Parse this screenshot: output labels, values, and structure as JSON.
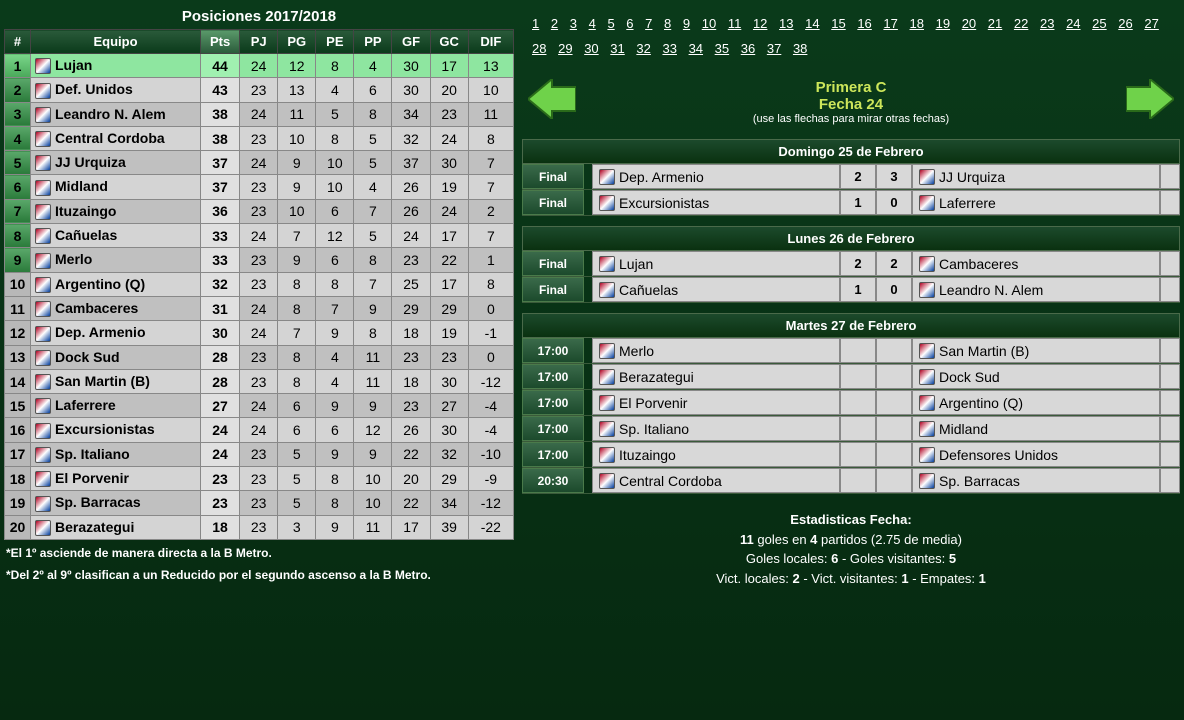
{
  "standings": {
    "title": "Posiciones 2017/2018",
    "headers": {
      "rank": "#",
      "team": "Equipo",
      "pts": "Pts",
      "pj": "PJ",
      "pg": "PG",
      "pe": "PE",
      "pp": "PP",
      "gf": "GF",
      "gc": "GC",
      "dif": "DIF"
    },
    "rows": [
      {
        "rank": "1",
        "team": "Lujan",
        "pts": "44",
        "pj": "24",
        "pg": "12",
        "pe": "8",
        "pp": "4",
        "gf": "30",
        "gc": "17",
        "dif": "13",
        "tier": "top"
      },
      {
        "rank": "2",
        "team": "Def. Unidos",
        "pts": "43",
        "pj": "23",
        "pg": "13",
        "pe": "4",
        "pp": "6",
        "gf": "30",
        "gc": "20",
        "dif": "10",
        "tier": "mid"
      },
      {
        "rank": "3",
        "team": "Leandro N. Alem",
        "pts": "38",
        "pj": "24",
        "pg": "11",
        "pe": "5",
        "pp": "8",
        "gf": "34",
        "gc": "23",
        "dif": "11",
        "tier": "mid"
      },
      {
        "rank": "4",
        "team": "Central Cordoba",
        "pts": "38",
        "pj": "23",
        "pg": "10",
        "pe": "8",
        "pp": "5",
        "gf": "32",
        "gc": "24",
        "dif": "8",
        "tier": "mid"
      },
      {
        "rank": "5",
        "team": "JJ Urquiza",
        "pts": "37",
        "pj": "24",
        "pg": "9",
        "pe": "10",
        "pp": "5",
        "gf": "37",
        "gc": "30",
        "dif": "7",
        "tier": "mid"
      },
      {
        "rank": "6",
        "team": "Midland",
        "pts": "37",
        "pj": "23",
        "pg": "9",
        "pe": "10",
        "pp": "4",
        "gf": "26",
        "gc": "19",
        "dif": "7",
        "tier": "mid"
      },
      {
        "rank": "7",
        "team": "Ituzaingo",
        "pts": "36",
        "pj": "23",
        "pg": "10",
        "pe": "6",
        "pp": "7",
        "gf": "26",
        "gc": "24",
        "dif": "2",
        "tier": "mid"
      },
      {
        "rank": "8",
        "team": "Cañuelas",
        "pts": "33",
        "pj": "24",
        "pg": "7",
        "pe": "12",
        "pp": "5",
        "gf": "24",
        "gc": "17",
        "dif": "7",
        "tier": "mid"
      },
      {
        "rank": "9",
        "team": "Merlo",
        "pts": "33",
        "pj": "23",
        "pg": "9",
        "pe": "6",
        "pp": "8",
        "gf": "23",
        "gc": "22",
        "dif": "1",
        "tier": "mid"
      },
      {
        "rank": "10",
        "team": "Argentino (Q)",
        "pts": "32",
        "pj": "23",
        "pg": "8",
        "pe": "8",
        "pp": "7",
        "gf": "25",
        "gc": "17",
        "dif": "8",
        "tier": "low"
      },
      {
        "rank": "11",
        "team": "Cambaceres",
        "pts": "31",
        "pj": "24",
        "pg": "8",
        "pe": "7",
        "pp": "9",
        "gf": "29",
        "gc": "29",
        "dif": "0",
        "tier": "low"
      },
      {
        "rank": "12",
        "team": "Dep. Armenio",
        "pts": "30",
        "pj": "24",
        "pg": "7",
        "pe": "9",
        "pp": "8",
        "gf": "18",
        "gc": "19",
        "dif": "-1",
        "tier": "low"
      },
      {
        "rank": "13",
        "team": "Dock Sud",
        "pts": "28",
        "pj": "23",
        "pg": "8",
        "pe": "4",
        "pp": "11",
        "gf": "23",
        "gc": "23",
        "dif": "0",
        "tier": "low"
      },
      {
        "rank": "14",
        "team": "San Martin (B)",
        "pts": "28",
        "pj": "23",
        "pg": "8",
        "pe": "4",
        "pp": "11",
        "gf": "18",
        "gc": "30",
        "dif": "-12",
        "tier": "low"
      },
      {
        "rank": "15",
        "team": "Laferrere",
        "pts": "27",
        "pj": "24",
        "pg": "6",
        "pe": "9",
        "pp": "9",
        "gf": "23",
        "gc": "27",
        "dif": "-4",
        "tier": "low"
      },
      {
        "rank": "16",
        "team": "Excursionistas",
        "pts": "24",
        "pj": "24",
        "pg": "6",
        "pe": "6",
        "pp": "12",
        "gf": "26",
        "gc": "30",
        "dif": "-4",
        "tier": "low"
      },
      {
        "rank": "17",
        "team": "Sp. Italiano",
        "pts": "24",
        "pj": "23",
        "pg": "5",
        "pe": "9",
        "pp": "9",
        "gf": "22",
        "gc": "32",
        "dif": "-10",
        "tier": "low"
      },
      {
        "rank": "18",
        "team": "El Porvenir",
        "pts": "23",
        "pj": "23",
        "pg": "5",
        "pe": "8",
        "pp": "10",
        "gf": "20",
        "gc": "29",
        "dif": "-9",
        "tier": "low"
      },
      {
        "rank": "19",
        "team": "Sp. Barracas",
        "pts": "23",
        "pj": "23",
        "pg": "5",
        "pe": "8",
        "pp": "10",
        "gf": "22",
        "gc": "34",
        "dif": "-12",
        "tier": "low"
      },
      {
        "rank": "20",
        "team": "Berazategui",
        "pts": "18",
        "pj": "23",
        "pg": "3",
        "pe": "9",
        "pp": "11",
        "gf": "17",
        "gc": "39",
        "dif": "-22",
        "tier": "low"
      }
    ],
    "footnote1": "*El 1º asciende de manera directa a la B Metro.",
    "footnote2": "*Del 2º al 9º clasifican a un Reducido por el segundo ascenso a la B Metro."
  },
  "fechaLinks": [
    "1",
    "2",
    "3",
    "4",
    "5",
    "6",
    "7",
    "8",
    "9",
    "10",
    "11",
    "12",
    "13",
    "14",
    "15",
    "16",
    "17",
    "18",
    "19",
    "20",
    "21",
    "22",
    "23",
    "24",
    "25",
    "26",
    "27",
    "28",
    "29",
    "30",
    "31",
    "32",
    "33",
    "34",
    "35",
    "36",
    "37",
    "38"
  ],
  "fixtureHeader": {
    "league": "Primera C",
    "fecha": "Fecha 24",
    "hint": "(use las flechas para mirar otras fechas)"
  },
  "days": [
    {
      "title": "Domingo 25 de Febrero",
      "matches": [
        {
          "status": "Final",
          "home": "Dep. Armenio",
          "hs": "2",
          "as": "3",
          "away": "JJ Urquiza"
        },
        {
          "status": "Final",
          "home": "Excursionistas",
          "hs": "1",
          "as": "0",
          "away": "Laferrere"
        }
      ]
    },
    {
      "title": "Lunes 26 de Febrero",
      "matches": [
        {
          "status": "Final",
          "home": "Lujan",
          "hs": "2",
          "as": "2",
          "away": "Cambaceres"
        },
        {
          "status": "Final",
          "home": "Cañuelas",
          "hs": "1",
          "as": "0",
          "away": "Leandro N. Alem"
        }
      ]
    },
    {
      "title": "Martes 27 de Febrero",
      "matches": [
        {
          "status": "17:00",
          "home": "Merlo",
          "hs": "",
          "as": "",
          "away": "San Martin (B)"
        },
        {
          "status": "17:00",
          "home": "Berazategui",
          "hs": "",
          "as": "",
          "away": "Dock Sud"
        },
        {
          "status": "17:00",
          "home": "El Porvenir",
          "hs": "",
          "as": "",
          "away": "Argentino (Q)"
        },
        {
          "status": "17:00",
          "home": "Sp. Italiano",
          "hs": "",
          "as": "",
          "away": "Midland"
        },
        {
          "status": "17:00",
          "home": "Ituzaingo",
          "hs": "",
          "as": "",
          "away": "Defensores Unidos"
        },
        {
          "status": "20:30",
          "home": "Central Cordoba",
          "hs": "",
          "as": "",
          "away": "Sp. Barracas"
        }
      ]
    }
  ],
  "stats": {
    "title": "Estadisticas Fecha:",
    "line1_a": "11",
    "line1_b": " goles en ",
    "line1_c": "4",
    "line1_d": " partidos (2.75 de media)",
    "line2_a": "Goles locales: ",
    "line2_b": "6",
    "line2_c": " - Goles visitantes: ",
    "line2_d": "5",
    "line3_a": "Vict. locales: ",
    "line3_b": "2",
    "line3_c": " - Vict. visitantes: ",
    "line3_d": "1",
    "line3_e": " - Empates: ",
    "line3_f": "1"
  }
}
